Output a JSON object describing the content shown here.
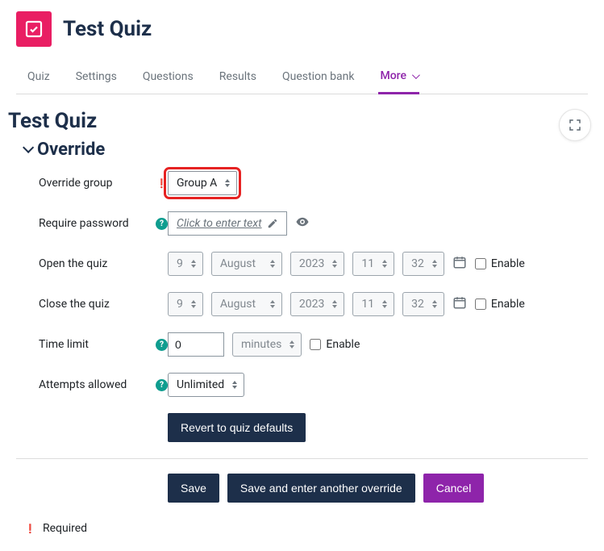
{
  "header": {
    "title": "Test Quiz"
  },
  "tabs": {
    "quiz": "Quiz",
    "settings": "Settings",
    "questions": "Questions",
    "results": "Results",
    "questionbank": "Question bank",
    "more": "More"
  },
  "section": {
    "heading": "Test Quiz",
    "subheading": "Override"
  },
  "form": {
    "override_group": {
      "label": "Override group",
      "value": "Group A"
    },
    "require_password": {
      "label": "Require password",
      "placeholder": "Click to enter text"
    },
    "open_quiz": {
      "label": "Open the quiz",
      "day": "9",
      "month": "August",
      "year": "2023",
      "hour": "11",
      "minute": "32",
      "enable_label": "Enable"
    },
    "close_quiz": {
      "label": "Close the quiz",
      "day": "9",
      "month": "August",
      "year": "2023",
      "hour": "11",
      "minute": "32",
      "enable_label": "Enable"
    },
    "time_limit": {
      "label": "Time limit",
      "value": "0",
      "unit": "minutes",
      "enable_label": "Enable"
    },
    "attempts": {
      "label": "Attempts allowed",
      "value": "Unlimited"
    },
    "revert_button": "Revert to quiz defaults"
  },
  "actions": {
    "save": "Save",
    "save_another": "Save and enter another override",
    "cancel": "Cancel"
  },
  "footer": {
    "required_label": "Required"
  }
}
